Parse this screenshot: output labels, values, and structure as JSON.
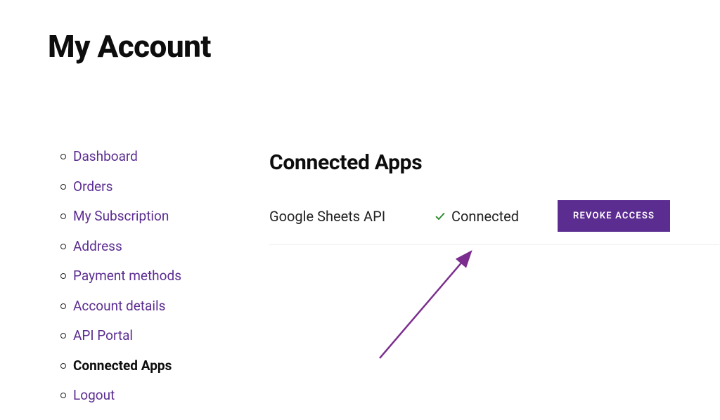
{
  "page_title": "My Account",
  "sidebar": {
    "items": [
      {
        "label": "Dashboard",
        "active": false
      },
      {
        "label": "Orders",
        "active": false
      },
      {
        "label": "My Subscription",
        "active": false
      },
      {
        "label": "Address",
        "active": false
      },
      {
        "label": "Payment methods",
        "active": false
      },
      {
        "label": "Account details",
        "active": false
      },
      {
        "label": "API Portal",
        "active": false
      },
      {
        "label": "Connected Apps",
        "active": true
      },
      {
        "label": "Logout",
        "active": false
      }
    ]
  },
  "main": {
    "section_title": "Connected Apps",
    "apps": [
      {
        "name": "Google Sheets API",
        "status": "Connected",
        "action_label": "REVOKE ACCESS"
      }
    ]
  },
  "colors": {
    "link": "#5c2d91",
    "button_bg": "#5c2d91",
    "check": "#2e8b2e"
  }
}
